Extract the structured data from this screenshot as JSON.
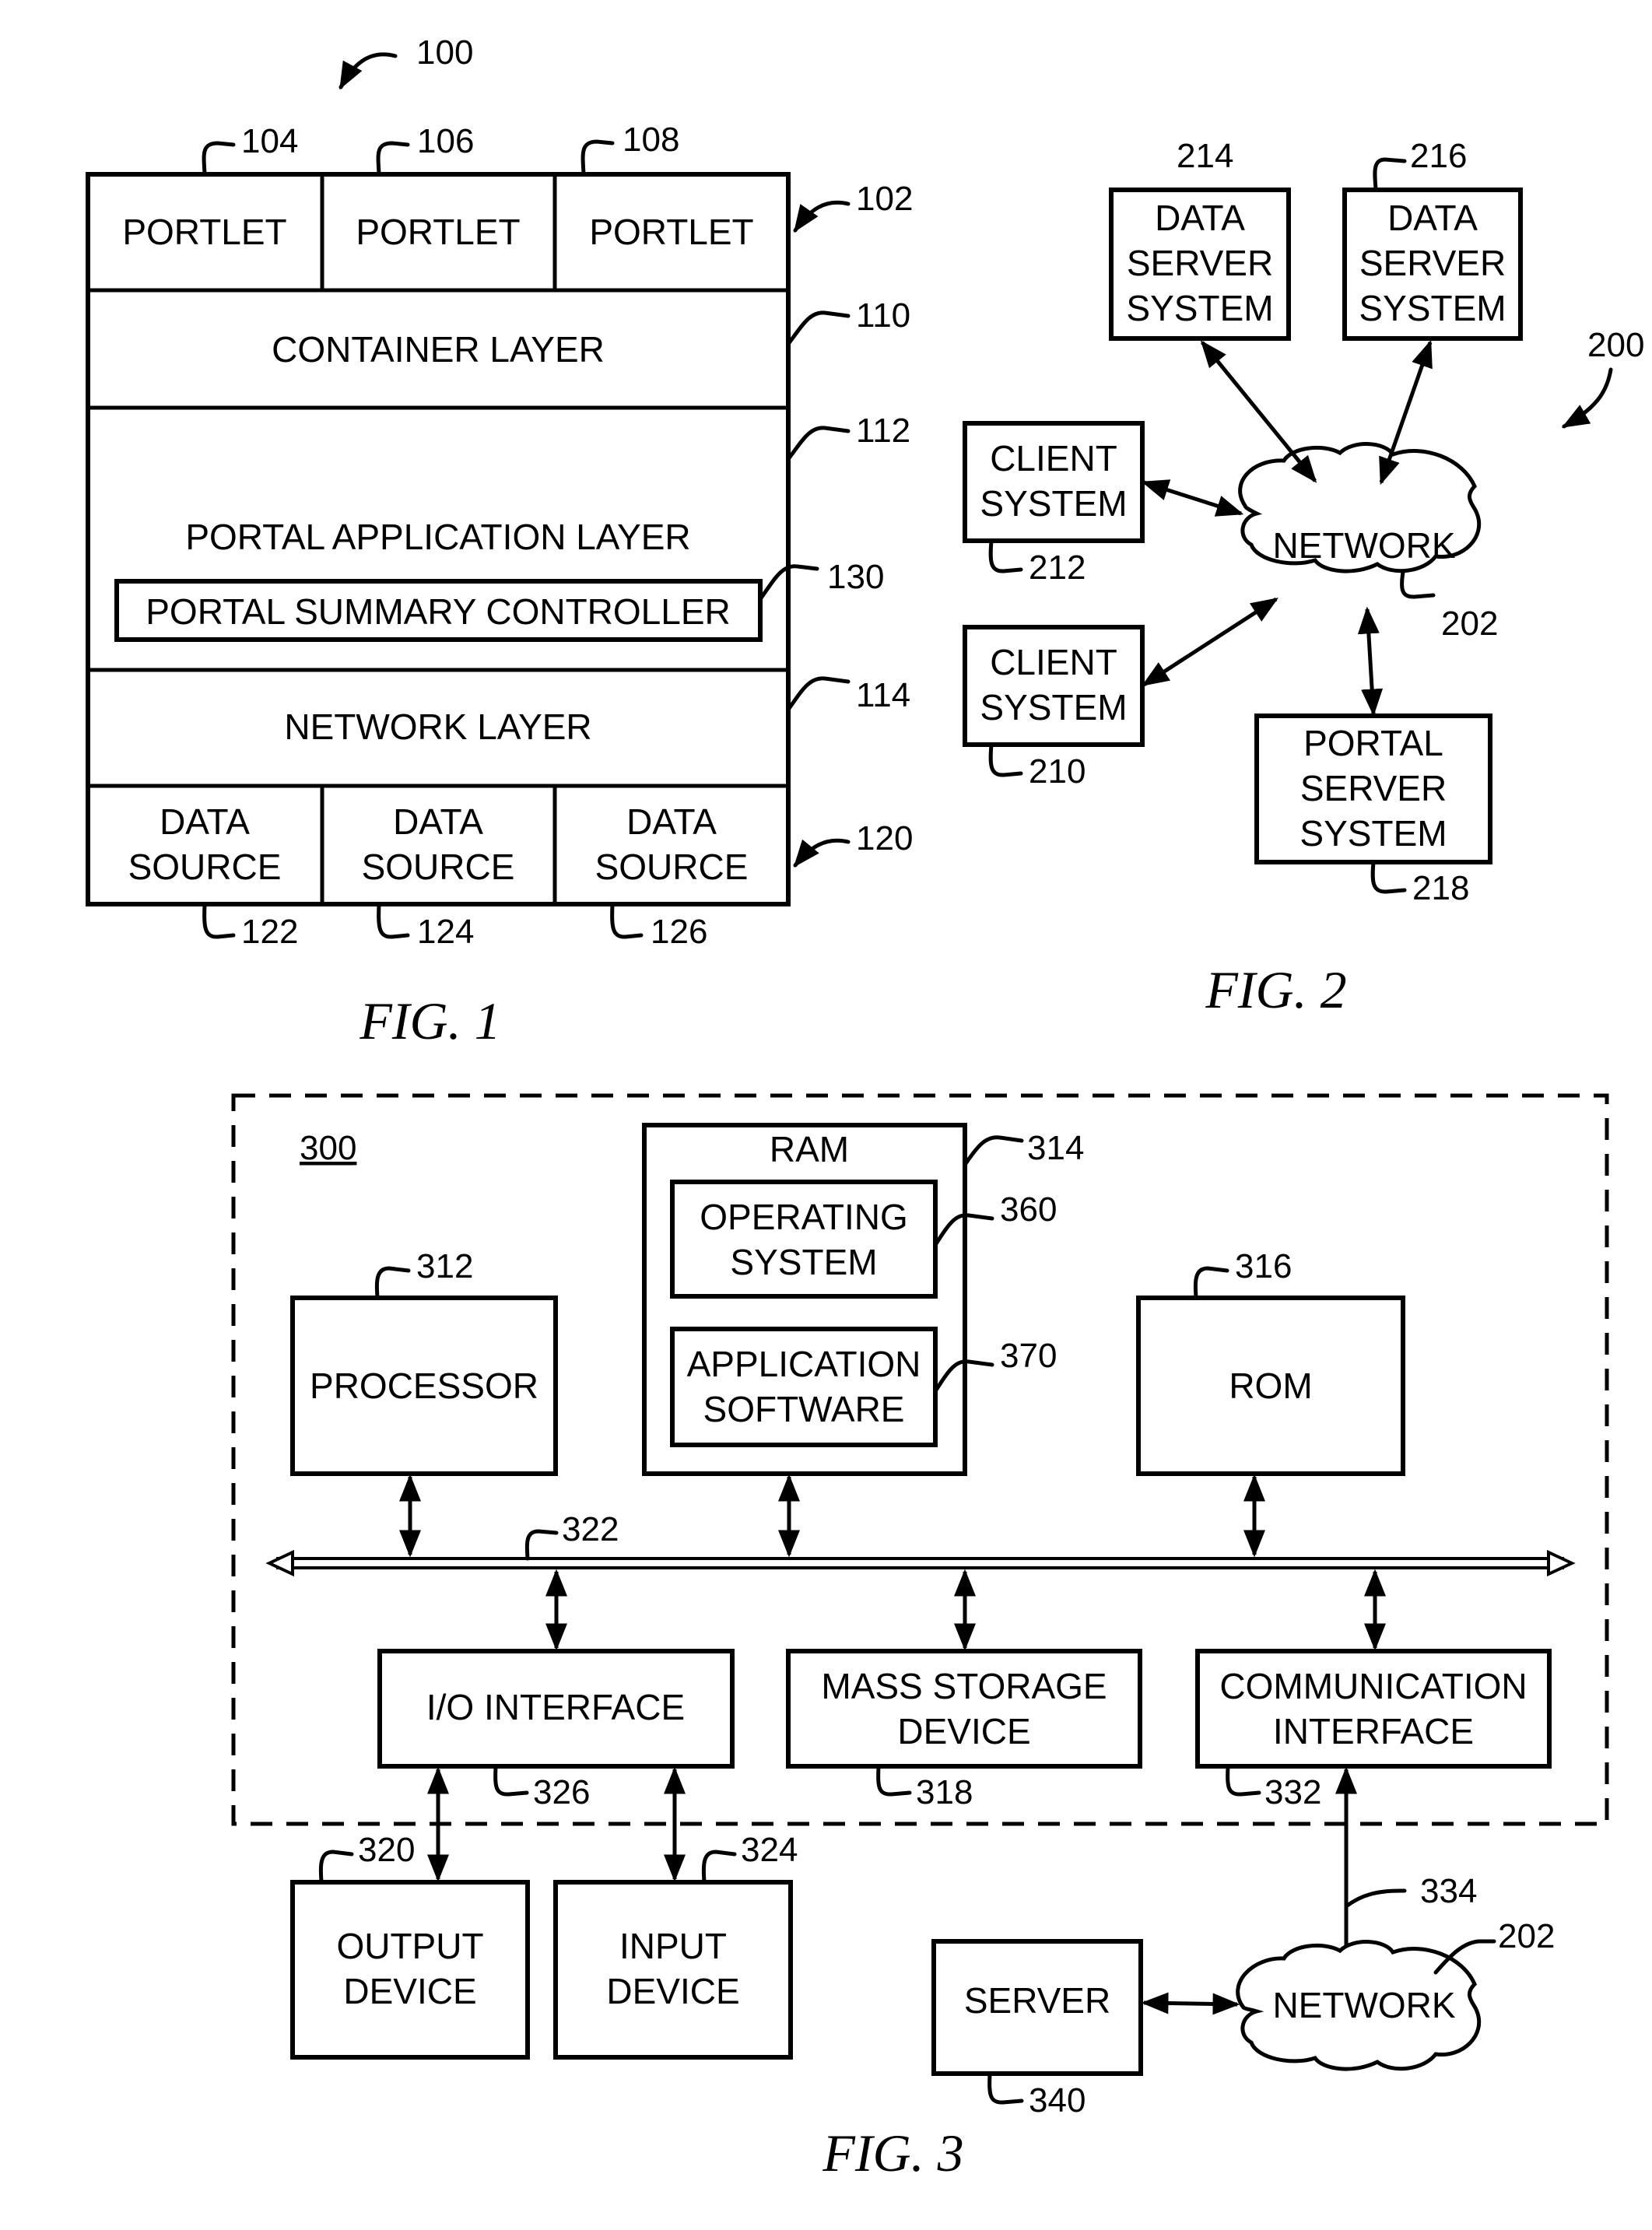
{
  "fig1": {
    "caption": "FIG. 1",
    "ref_main": "100",
    "ref_portlet_row": "102",
    "portlets": [
      {
        "label": "PORTLET",
        "ref": "104"
      },
      {
        "label": "PORTLET",
        "ref": "106"
      },
      {
        "label": "PORTLET",
        "ref": "108"
      }
    ],
    "container_layer": {
      "label": "CONTAINER LAYER",
      "ref": "110"
    },
    "portal_application_layer": {
      "label": "PORTAL APPLICATION LAYER",
      "ref": "112"
    },
    "portal_summary_controller": {
      "label": "PORTAL SUMMARY CONTROLLER",
      "ref": "130"
    },
    "network_layer": {
      "label": "NETWORK LAYER",
      "ref": "114"
    },
    "ref_data_source_row": "120",
    "data_sources": [
      {
        "line1": "DATA",
        "line2": "SOURCE",
        "ref": "122"
      },
      {
        "line1": "DATA",
        "line2": "SOURCE",
        "ref": "124"
      },
      {
        "line1": "DATA",
        "line2": "SOURCE",
        "ref": "126"
      }
    ]
  },
  "fig2": {
    "caption": "FIG. 2",
    "ref_main": "200",
    "network": {
      "label": "NETWORK",
      "ref": "202"
    },
    "data_server_1": {
      "lines": [
        "DATA",
        "SERVER",
        "SYSTEM"
      ],
      "ref": "214"
    },
    "data_server_2": {
      "lines": [
        "DATA",
        "SERVER",
        "SYSTEM"
      ],
      "ref": "216"
    },
    "client_1": {
      "lines": [
        "CLIENT",
        "SYSTEM"
      ],
      "ref": "212"
    },
    "client_2": {
      "lines": [
        "CLIENT",
        "SYSTEM"
      ],
      "ref": "210"
    },
    "portal_server": {
      "lines": [
        "PORTAL",
        "SERVER",
        "SYSTEM"
      ],
      "ref": "218"
    }
  },
  "fig3": {
    "caption": "FIG. 3",
    "ref_main": "300",
    "ram": {
      "label": "RAM",
      "ref": "314"
    },
    "operating_system": {
      "lines": [
        "OPERATING",
        "SYSTEM"
      ],
      "ref": "360"
    },
    "application_software": {
      "lines": [
        "APPLICATION",
        "SOFTWARE"
      ],
      "ref": "370"
    },
    "processor": {
      "label": "PROCESSOR",
      "ref": "312"
    },
    "rom": {
      "label": "ROM",
      "ref": "316"
    },
    "bus": {
      "ref": "322"
    },
    "io_interface": {
      "label": "I/O INTERFACE",
      "ref": "326"
    },
    "mass_storage": {
      "lines": [
        "MASS STORAGE",
        "DEVICE"
      ],
      "ref": "318"
    },
    "communication_interface": {
      "lines": [
        "COMMUNICATION",
        "INTERFACE"
      ],
      "ref": "332"
    },
    "output_device": {
      "lines": [
        "OUTPUT",
        "DEVICE"
      ],
      "ref": "320"
    },
    "input_device": {
      "lines": [
        "INPUT",
        "DEVICE"
      ],
      "ref": "324"
    },
    "network_link": {
      "ref": "334"
    },
    "server": {
      "label": "SERVER",
      "ref": "340"
    },
    "network": {
      "label": "NETWORK",
      "ref": "202"
    }
  }
}
